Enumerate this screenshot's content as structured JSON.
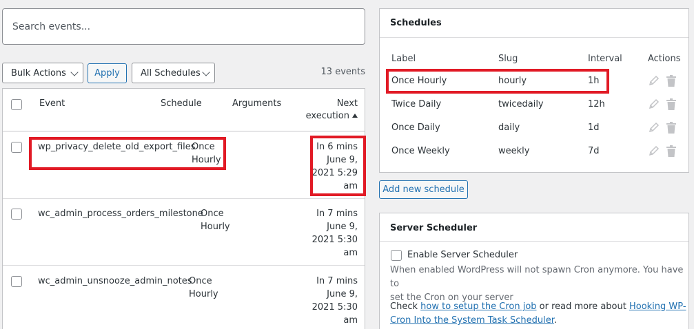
{
  "search": {
    "placeholder": "Search events..."
  },
  "toolbar": {
    "bulk_actions": "Bulk Actions",
    "apply": "Apply",
    "schedules_filter": "All Schedules",
    "count": "13 events"
  },
  "table": {
    "headers": {
      "event": "Event",
      "schedule": "Schedule",
      "arguments": "Arguments",
      "next_1": "Next",
      "next_2": "execution"
    },
    "rows": [
      {
        "event": "wp_privacy_delete_old_export_files",
        "schedule_1": "Once",
        "schedule_2": "Hourly",
        "next_1": "In 6 mins",
        "next_2": "June 9,",
        "next_3": "2021 5:29",
        "next_4": "am"
      },
      {
        "event": "wc_admin_process_orders_milestone",
        "schedule_1": "Once",
        "schedule_2": "Hourly",
        "next_1": "In 7 mins",
        "next_2": "June 9,",
        "next_3": "2021 5:30",
        "next_4": "am"
      },
      {
        "event": "wc_admin_unsnooze_admin_notes",
        "schedule_1": "Once",
        "schedule_2": "Hourly",
        "next_1": "In 7 mins",
        "next_2": "June 9,",
        "next_3": "2021 5:30",
        "next_4": "am"
      }
    ]
  },
  "schedules": {
    "title": "Schedules",
    "headers": {
      "label": "Label",
      "slug": "Slug",
      "interval": "Interval",
      "actions": "Actions"
    },
    "rows": [
      {
        "label": "Once Hourly",
        "slug": "hourly",
        "interval": "1h"
      },
      {
        "label": "Twice Daily",
        "slug": "twicedaily",
        "interval": "12h"
      },
      {
        "label": "Once Daily",
        "slug": "daily",
        "interval": "1d"
      },
      {
        "label": "Once Weekly",
        "slug": "weekly",
        "interval": "7d"
      }
    ],
    "add_button": "Add new schedule"
  },
  "server": {
    "title": "Server Scheduler",
    "enable_label": "Enable Server Scheduler",
    "desc_1": "When enabled WordPress will not spawn Cron anymore. You have to",
    "desc_2": "set the Cron on your server",
    "check": "Check",
    "link_setup": "how to setup the Cron job",
    "or_read": "or read more about",
    "link_hooking_1": "Hooking WP-",
    "link_hooking_2": "Cron Into the System Task Scheduler",
    "period": "."
  },
  "icons": {
    "edit": "pencil-icon",
    "delete": "trash-icon",
    "dropdown": "chevron-down-icon",
    "sort": "sort-up-icon"
  },
  "colors": {
    "accent": "#2271b1",
    "highlight": "#e11a25"
  }
}
